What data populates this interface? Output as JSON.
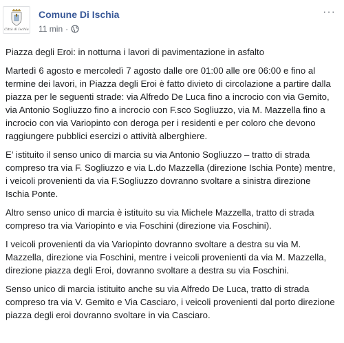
{
  "post": {
    "author": "Comune Di Ischia",
    "time": "11 min",
    "separator": "·",
    "avatar_caption": "Città di Ischia",
    "more": "···",
    "paragraphs": [
      "Piazza degli Eroi: in notturna i lavori di pavimentazione in asfalto",
      "Martedì 6 agosto e mercoledì 7 agosto dalle ore 01:00 alle ore 06:00 e fino al termine dei lavori, in Piazza degli Eroi è fatto divieto di circolazione a partire dalla piazza per le seguenti strade: via Alfredo De Luca fino a incrocio con via Gemito, via Antonio Sogliuzzo fino a incrocio con F.sco Sogliuzzo, via M. Mazzella fino a incrocio con via Variopinto con deroga per i residenti e per coloro che devono raggiungere pubblici esercizi o attività alberghiere.",
      "E’ istituito il senso unico di marcia su via Antonio Sogliuzzo – tratto di strada compreso tra via F. Sogliuzzo e via L.do Mazzella (direzione Ischia Ponte) mentre, i veicoli provenienti da via F.Sogliuzzo dovranno svoltare a sinistra direzione Ischia Ponte.",
      "Altro senso unico di marcia è istituito su via Michele Mazzella, tratto di strada compreso tra via Variopinto e via Foschini (direzione via Foschini).",
      "I veicoli provenienti da via Variopinto dovranno svoltare a destra su via M. Mazzella, direzione via Foschini, mentre i veicoli provenienti da via M. Mazzella, direzione piazza degli Eroi, dovranno svoltare a destra su via Foschini.",
      "Senso unico di marcia istituito anche su via Alfredo De Luca, tratto di strada compreso tra via V. Gemito e Via Casciaro, i veicoli provenienti dal porto direzione piazza degli eroi dovranno svoltare in via Casciaro."
    ]
  },
  "colors": {
    "link": "#385898",
    "meta": "#606770",
    "text": "#1c1e21"
  },
  "icons": {
    "avatar": "coat-of-arms-icon",
    "privacy": "globe-icon",
    "menu": "more-options-icon"
  }
}
